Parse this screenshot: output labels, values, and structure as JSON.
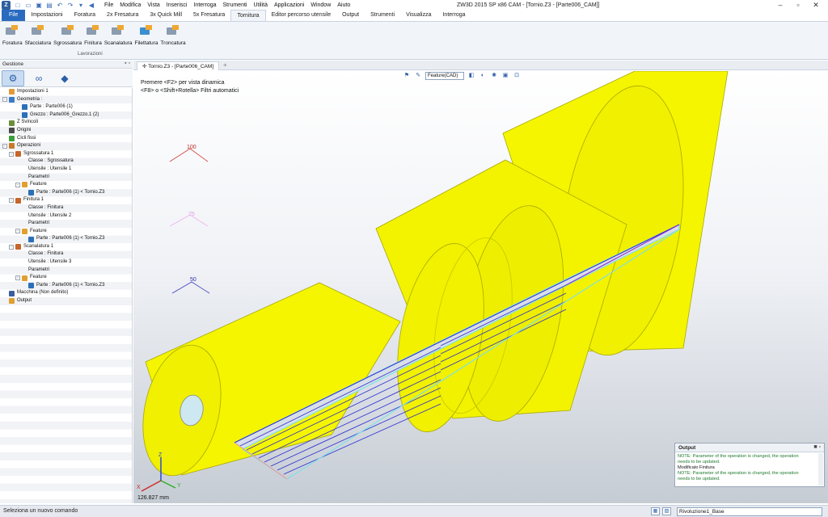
{
  "titlebar": {
    "logo": "Z",
    "quick_access": [
      "new-icon",
      "open-icon",
      "save-icon",
      "save-all-icon",
      "undo-icon",
      "redo-icon",
      "dropdown-icon",
      "back-icon"
    ],
    "menu": [
      "File",
      "Modifica",
      "Vista",
      "Inserisci",
      "Interroga",
      "Strumenti",
      "Utilità",
      "Applicazioni",
      "Window",
      "Aiuto"
    ],
    "window_title": "ZW3D 2015 SP x86       CAM - [Tornio.Z3 - [Parte006_CAM]]"
  },
  "ribbon": {
    "tabs": [
      "File",
      "Impostazioni",
      "Foratura",
      "2x Fresatura",
      "3x Quick Mill",
      "5x Fresatura",
      "Tornitura",
      "Editor percorso utensile",
      "Output",
      "Strumenti",
      "Visualizza",
      "Interroga"
    ],
    "active_tab": "Tornitura",
    "buttons": [
      "Foratura",
      "Sfacciatura",
      "Sgrossatura",
      "Finitura",
      "Scanalatura",
      "Filettatura",
      "Troncatura"
    ],
    "group_label": "Lavorazioni"
  },
  "left_panel": {
    "title": "Gestione",
    "tree": [
      {
        "label": "Impostazioni 1",
        "depth": 0,
        "exp": "",
        "color": "#e09a3a"
      },
      {
        "label": "Geometria :",
        "depth": 0,
        "exp": "-",
        "color": "#3a7bc8"
      },
      {
        "label": "Parte : Parte006 (1)",
        "depth": 2,
        "exp": "",
        "color": "#2b6fb8"
      },
      {
        "label": "Grezzo : Parte006_Grezzo.1 (2)",
        "depth": 2,
        "exp": "",
        "color": "#2b6fb8"
      },
      {
        "label": "Z Svincoli",
        "depth": 0,
        "exp": "",
        "color": "#6b8e3a"
      },
      {
        "label": "Origini",
        "depth": 0,
        "exp": "",
        "color": "#4a4a4a"
      },
      {
        "label": "Cicli fissi",
        "depth": 0,
        "exp": "",
        "color": "#3a9e3a"
      },
      {
        "label": "Operazioni",
        "depth": 0,
        "exp": "-",
        "color": "#c87a2a"
      },
      {
        "label": "Sgrossatura 1",
        "depth": 1,
        "exp": "-",
        "color": "#c8642a"
      },
      {
        "label": "Classe : Sgrossatura",
        "depth": 3,
        "exp": "",
        "color": ""
      },
      {
        "label": "Utensile : Utensile 1",
        "depth": 3,
        "exp": "",
        "color": ""
      },
      {
        "label": "Parametri",
        "depth": 3,
        "exp": "",
        "color": ""
      },
      {
        "label": "Feature",
        "depth": 2,
        "exp": "-",
        "color": "#e0a030"
      },
      {
        "label": "Parte : Parte006 (1) < Tornio.Z3",
        "depth": 3,
        "exp": "",
        "color": "#2b6fb8"
      },
      {
        "label": "Finitura 1",
        "depth": 1,
        "exp": "-",
        "color": "#c8642a"
      },
      {
        "label": "Classe : Finitura",
        "depth": 3,
        "exp": "",
        "color": ""
      },
      {
        "label": "Utensile : Utensile 2",
        "depth": 3,
        "exp": "",
        "color": ""
      },
      {
        "label": "Parametri",
        "depth": 3,
        "exp": "",
        "color": ""
      },
      {
        "label": "Feature",
        "depth": 2,
        "exp": "-",
        "color": "#e0a030"
      },
      {
        "label": "Parte : Parte006 (1) < Tornio.Z3",
        "depth": 3,
        "exp": "",
        "color": "#2b6fb8"
      },
      {
        "label": "Scanalatura 1",
        "depth": 1,
        "exp": "-",
        "color": "#c8642a"
      },
      {
        "label": "Classe : Finitura",
        "depth": 3,
        "exp": "",
        "color": ""
      },
      {
        "label": "Utensile : Utensile 3",
        "depth": 3,
        "exp": "",
        "color": ""
      },
      {
        "label": "Parametri",
        "depth": 3,
        "exp": "",
        "color": ""
      },
      {
        "label": "Feature",
        "depth": 2,
        "exp": "-",
        "color": "#e0a030"
      },
      {
        "label": "Parte : Parte006 (1) < Tornio.Z3",
        "depth": 3,
        "exp": "",
        "color": "#2b6fb8"
      },
      {
        "label": "Macchina (Non definito)",
        "depth": 0,
        "exp": "",
        "color": "#3a5e9e"
      },
      {
        "label": "Output",
        "depth": 0,
        "exp": "",
        "color": "#e0a030"
      }
    ]
  },
  "document": {
    "tab_label": "Tornio.Z3 - [Parte006_CAM]",
    "add_tab": "+"
  },
  "viewport": {
    "hint_line1": "Premere <F2> per vista dinamica",
    "hint_line2": "<F8> o <Shift+Rotella> Filtri automatici",
    "filter_value": "Feature(CAD)",
    "scale_readout": "126.827 mm",
    "axis_x": "X",
    "axis_y": "Y",
    "axis_z": "Z",
    "marker_100": "100",
    "marker_75": "75",
    "marker_50": "50",
    "part_color": "#f5f500",
    "edge_color": "#a8a800",
    "path_color_blue": "#2a2ad0",
    "path_color_cyan": "#7fe0e8"
  },
  "output": {
    "title": "Output",
    "lines": [
      {
        "text": "NOTE: Parameter of the operation is changed, the operation",
        "kind": "n"
      },
      {
        "text": "needs to be updated.",
        "kind": "n"
      },
      {
        "text": "Modificato Finitura",
        "kind": "m"
      },
      {
        "text": "NOTE: Parameter of the operation is changed, the operation",
        "kind": "n"
      },
      {
        "text": "needs to be updated.",
        "kind": "n"
      }
    ]
  },
  "statusbar": {
    "text": "Seleziona un nuovo comando",
    "input_value": "Rivoluzione1_Base"
  }
}
